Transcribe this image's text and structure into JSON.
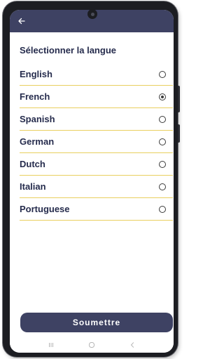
{
  "header": {
    "back_icon": "arrow-left-icon"
  },
  "page": {
    "title": "Sélectionner la langue"
  },
  "languages": [
    {
      "label": "English",
      "selected": false
    },
    {
      "label": "French",
      "selected": true
    },
    {
      "label": "Spanish",
      "selected": false
    },
    {
      "label": "German",
      "selected": false
    },
    {
      "label": "Dutch",
      "selected": false
    },
    {
      "label": "Italian",
      "selected": false
    },
    {
      "label": "Portuguese",
      "selected": false
    }
  ],
  "submit": {
    "label": "Soumettre"
  },
  "navigation": {
    "recents_icon": "recents-icon",
    "home_icon": "home-icon",
    "back_icon": "back-chevron-icon"
  },
  "colors": {
    "header_bg": "#3e4263",
    "text": "#262c4d",
    "divider": "#e9cf5f",
    "button_bg": "#3e4263"
  }
}
